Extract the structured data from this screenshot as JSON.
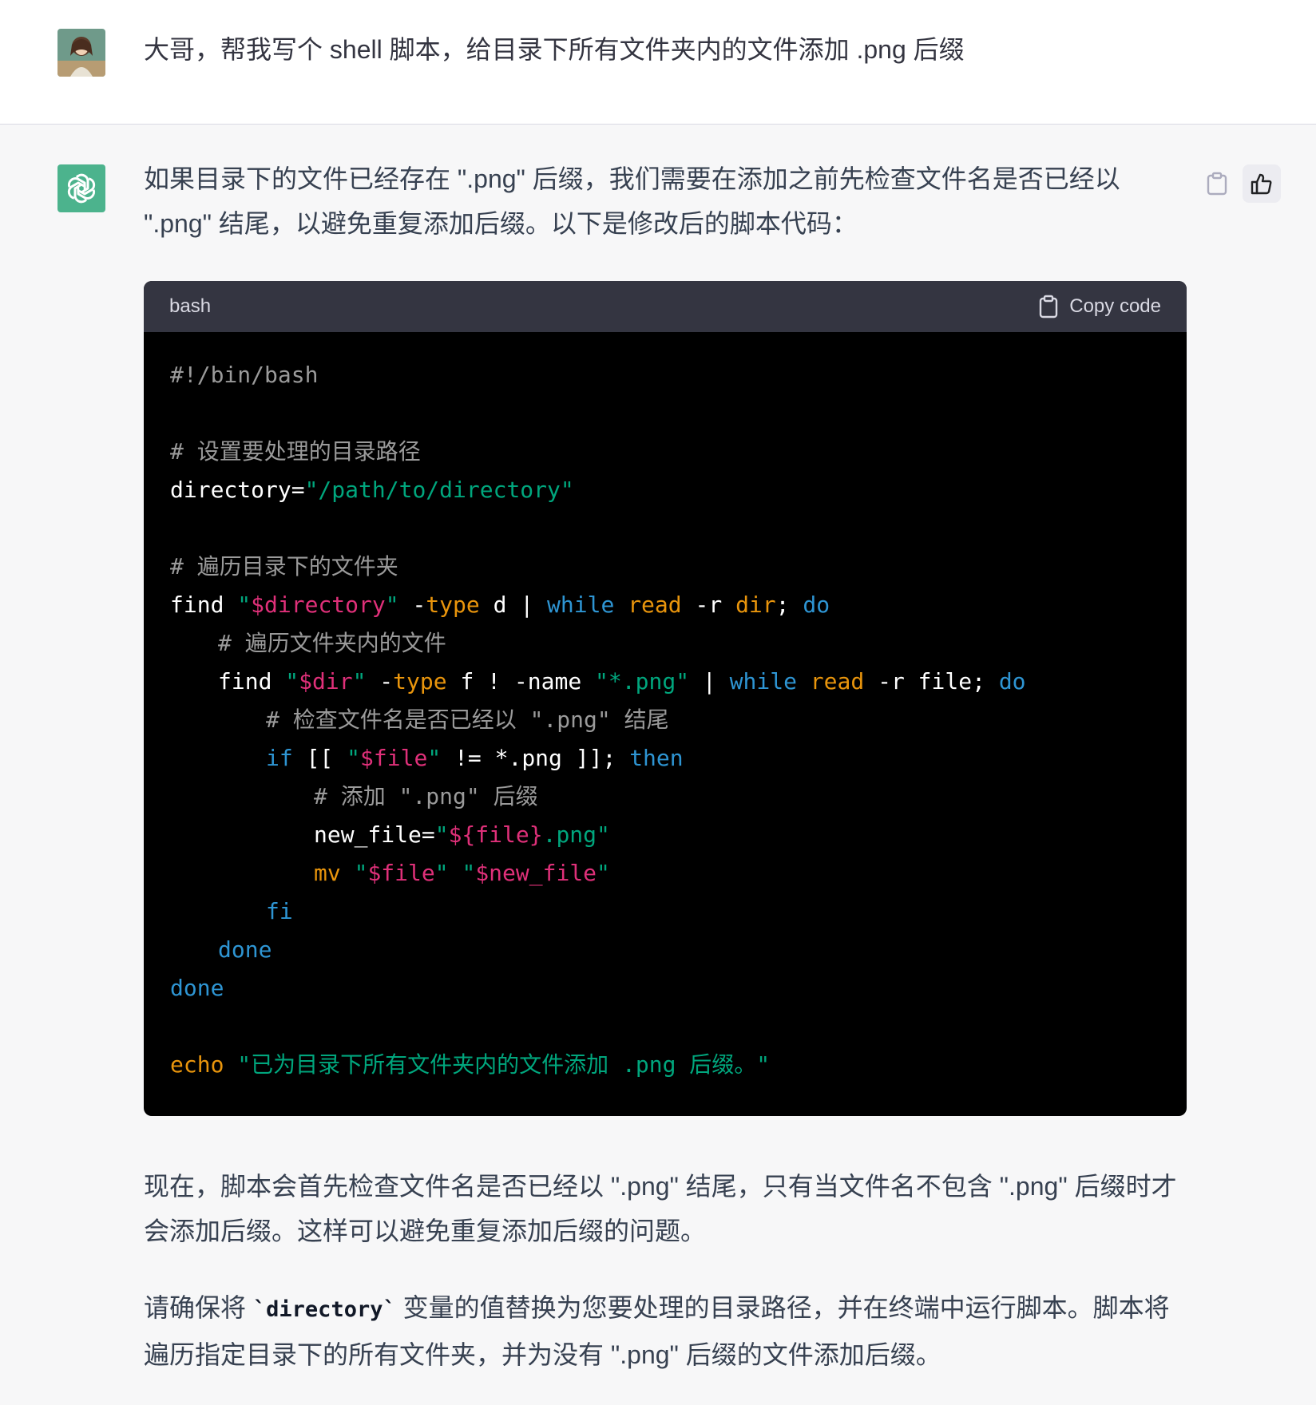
{
  "user_message": {
    "avatar_icon": "user-avatar-anime-girl",
    "text": "大哥，帮我写个 shell 脚本，给目录下所有文件夹内的文件添加 .png 后缀"
  },
  "assistant_message": {
    "avatar_icon": "openai-logo-icon",
    "intro": "如果目录下的文件已经存在 \".png\" 后缀，我们需要在添加之前先检查文件名是否已经以 \".png\" 结尾，以避免重复添加后缀。以下是修改后的脚本代码：",
    "code_block": {
      "language": "bash",
      "copy_label": "Copy code",
      "lines": [
        {
          "indent": 0,
          "tokens": [
            {
              "t": "#!/bin/bash",
              "c": "cm"
            }
          ]
        },
        {
          "indent": 0,
          "tokens": []
        },
        {
          "indent": 0,
          "tokens": [
            {
              "t": "# 设置要处理的目录路径",
              "c": "cm"
            }
          ]
        },
        {
          "indent": 0,
          "tokens": [
            {
              "t": "directory=",
              "c": "plain"
            },
            {
              "t": "\"/path/to/directory\"",
              "c": "str"
            }
          ]
        },
        {
          "indent": 0,
          "tokens": []
        },
        {
          "indent": 0,
          "tokens": [
            {
              "t": "# 遍历目录下的文件夹",
              "c": "cm"
            }
          ]
        },
        {
          "indent": 0,
          "tokens": [
            {
              "t": "find ",
              "c": "plain"
            },
            {
              "t": "\"",
              "c": "str"
            },
            {
              "t": "$directory",
              "c": "var"
            },
            {
              "t": "\"",
              "c": "str"
            },
            {
              "t": " -",
              "c": "plain"
            },
            {
              "t": "type",
              "c": "bi"
            },
            {
              "t": " d | ",
              "c": "plain"
            },
            {
              "t": "while",
              "c": "kw"
            },
            {
              "t": " ",
              "c": "plain"
            },
            {
              "t": "read",
              "c": "bi"
            },
            {
              "t": " -r ",
              "c": "plain"
            },
            {
              "t": "dir",
              "c": "bi"
            },
            {
              "t": "; ",
              "c": "plain"
            },
            {
              "t": "do",
              "c": "kw"
            }
          ]
        },
        {
          "indent": 1,
          "tokens": [
            {
              "t": "# 遍历文件夹内的文件",
              "c": "cm"
            }
          ]
        },
        {
          "indent": 1,
          "tokens": [
            {
              "t": "find ",
              "c": "plain"
            },
            {
              "t": "\"",
              "c": "str"
            },
            {
              "t": "$dir",
              "c": "var"
            },
            {
              "t": "\"",
              "c": "str"
            },
            {
              "t": " -",
              "c": "plain"
            },
            {
              "t": "type",
              "c": "bi"
            },
            {
              "t": " f ! -name ",
              "c": "plain"
            },
            {
              "t": "\"*.png\"",
              "c": "str"
            },
            {
              "t": " | ",
              "c": "plain"
            },
            {
              "t": "while",
              "c": "kw"
            },
            {
              "t": " ",
              "c": "plain"
            },
            {
              "t": "read",
              "c": "bi"
            },
            {
              "t": " -r file; ",
              "c": "plain"
            },
            {
              "t": "do",
              "c": "kw"
            }
          ]
        },
        {
          "indent": 2,
          "tokens": [
            {
              "t": "# 检查文件名是否已经以 \".png\" 结尾",
              "c": "cm"
            }
          ]
        },
        {
          "indent": 2,
          "tokens": [
            {
              "t": "if",
              "c": "kw"
            },
            {
              "t": " [[ ",
              "c": "plain"
            },
            {
              "t": "\"",
              "c": "str"
            },
            {
              "t": "$file",
              "c": "var"
            },
            {
              "t": "\"",
              "c": "str"
            },
            {
              "t": " != *.png ]]; ",
              "c": "plain"
            },
            {
              "t": "then",
              "c": "kw"
            }
          ]
        },
        {
          "indent": 3,
          "tokens": [
            {
              "t": "# 添加 \".png\" 后缀",
              "c": "cm"
            }
          ]
        },
        {
          "indent": 3,
          "tokens": [
            {
              "t": "new_file=",
              "c": "plain"
            },
            {
              "t": "\"",
              "c": "str"
            },
            {
              "t": "${file}",
              "c": "var"
            },
            {
              "t": ".png\"",
              "c": "str"
            }
          ]
        },
        {
          "indent": 3,
          "tokens": [
            {
              "t": "mv",
              "c": "bi"
            },
            {
              "t": " ",
              "c": "plain"
            },
            {
              "t": "\"",
              "c": "str"
            },
            {
              "t": "$file",
              "c": "var"
            },
            {
              "t": "\"",
              "c": "str"
            },
            {
              "t": " ",
              "c": "plain"
            },
            {
              "t": "\"",
              "c": "str"
            },
            {
              "t": "$new_file",
              "c": "var"
            },
            {
              "t": "\"",
              "c": "str"
            }
          ]
        },
        {
          "indent": 2,
          "tokens": [
            {
              "t": "fi",
              "c": "kw"
            }
          ]
        },
        {
          "indent": 1,
          "tokens": [
            {
              "t": "done",
              "c": "kw"
            }
          ]
        },
        {
          "indent": 0,
          "tokens": [
            {
              "t": "done",
              "c": "kw"
            }
          ]
        },
        {
          "indent": 0,
          "tokens": []
        },
        {
          "indent": 0,
          "tokens": [
            {
              "t": "echo",
              "c": "bi"
            },
            {
              "t": " ",
              "c": "plain"
            },
            {
              "t": "\"已为目录下所有文件夹内的文件添加 .png 后缀。\"",
              "c": "str"
            }
          ]
        }
      ]
    },
    "outro_1": "现在，脚本会首先检查文件名是否已经以 \".png\" 结尾，只有当文件名不包含 \".png\" 后缀时才会添加后缀。这样可以避免重复添加后缀的问题。",
    "outro_2_prefix": "请确保将 ",
    "outro_2_code": "`directory`",
    "outro_2_suffix": " 变量的值替换为您要处理的目录路径，并在终端中运行脚本。脚本将遍历指定目录下的所有文件夹，并为没有 \".png\" 后缀的文件添加后缀。"
  },
  "actions": {
    "copy_icon": "clipboard-icon",
    "like_icon": "thumbs-up-icon"
  },
  "colors": {
    "openai_green": "#4cb38d",
    "code_header": "#343541",
    "code_bg": "#000000",
    "string": "#00a67d",
    "variable": "#df3079",
    "keyword": "#2e95d3",
    "builtin": "#e9950c",
    "comment": "#9a9a9a"
  }
}
